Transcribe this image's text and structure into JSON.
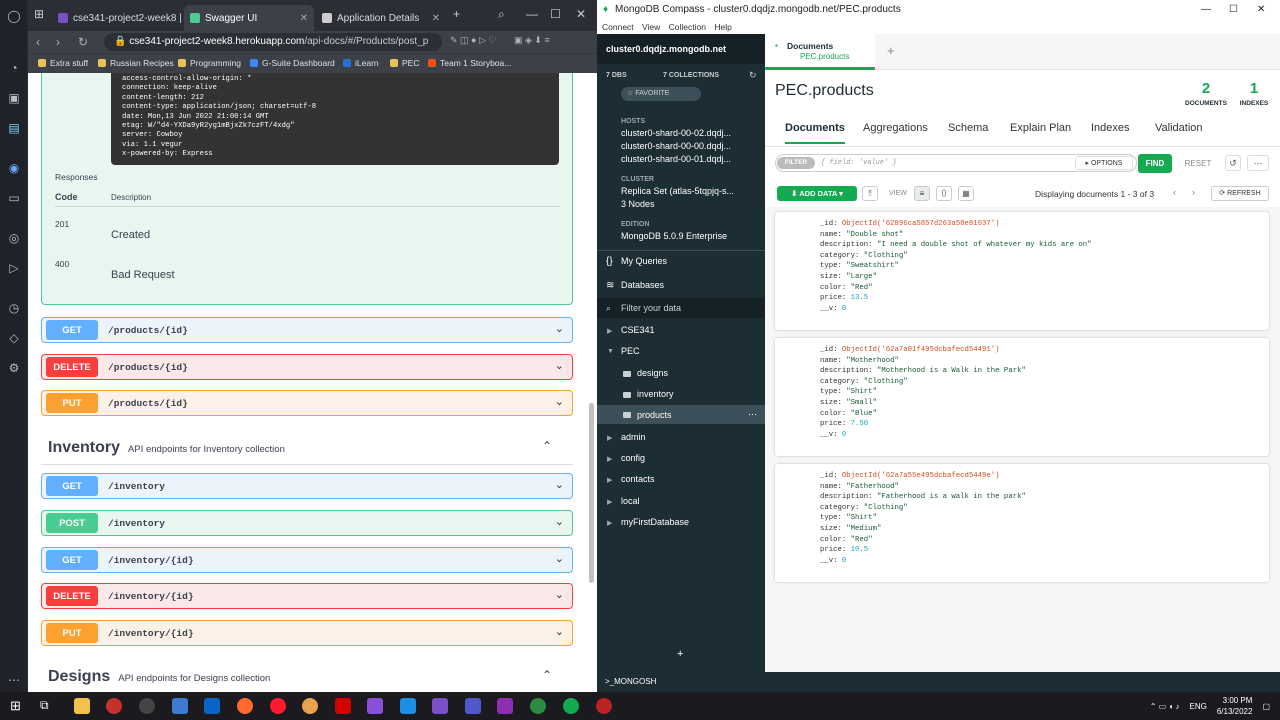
{
  "browser": {
    "tabs": [
      {
        "label": "cse341-project2-week8 | H",
        "color": "#7b4fc9"
      },
      {
        "label": "Swagger UI",
        "color": "#49cc90"
      },
      {
        "label": "Application Details",
        "color": "#cccccc"
      }
    ],
    "url_host": "cse341-project2-week8.herokuapp.com",
    "url_path": "/api-docs/#/Products/post_p",
    "bookmarks": [
      "Extra stuff",
      "Russian Recipes",
      "Programming",
      "G-Suite Dashboard",
      "iLearn",
      "PEC",
      "Team 1 Storyboa..."
    ]
  },
  "swagger": {
    "headers": [
      "access-control-allow-origin: *",
      "connection: keep-alive",
      "content-length: 212",
      "content-type: application/json; charset=utf-8",
      "date: Mon,13 Jun 2022 21:00:14 GMT",
      "etag: W/\"d4-YXDa9yR2yg1mBjxZk7czFT/4xdg\"",
      "server: Cowboy",
      "via: 1.1 vegur",
      "x-powered-by: Express"
    ],
    "responses_label": "Responses",
    "col_code": "Code",
    "col_desc": "Description",
    "responses": [
      {
        "code": "201",
        "desc": "Created"
      },
      {
        "code": "400",
        "desc": "Bad Request"
      }
    ],
    "product_ops": [
      {
        "method": "GET",
        "path": "/products/{id}"
      },
      {
        "method": "DELETE",
        "path": "/products/{id}"
      },
      {
        "method": "PUT",
        "path": "/products/{id}"
      }
    ],
    "inventory": {
      "name": "Inventory",
      "desc": "API endpoints for Inventory collection"
    },
    "inventory_ops": [
      {
        "method": "GET",
        "path": "/inventory"
      },
      {
        "method": "POST",
        "path": "/inventory"
      },
      {
        "method": "GET",
        "path": "/inventory/{id}"
      },
      {
        "method": "DELETE",
        "path": "/inventory/{id}"
      },
      {
        "method": "PUT",
        "path": "/inventory/{id}"
      }
    ],
    "designs": {
      "name": "Designs",
      "desc": "API endpoints for Designs collection"
    }
  },
  "compass": {
    "title": "MongoDB Compass - cluster0.dqdjz.mongodb.net/PEC.products",
    "menu": "Connect View Collection Help",
    "cluster": "cluster0.dqdjz.mongodb.net",
    "dbs": "7 DBS",
    "collections": "7 COLLECTIONS",
    "favorite": "☆ FAVORITE",
    "hosts_label": "HOSTS",
    "hosts": [
      "cluster0-shard-00-02.dqdj...",
      "cluster0-shard-00-00.dqdj...",
      "cluster0-shard-00-01.dqdj..."
    ],
    "cluster_label": "CLUSTER",
    "cluster_val": "Replica Set (atlas-5tqpjq-s...",
    "nodes": "3 Nodes",
    "edition_label": "EDITION",
    "edition": "MongoDB 5.0.9 Enterprise",
    "my_queries": "My Queries",
    "databases": "Databases",
    "filter_placeholder": "Filter your data",
    "dbs_tree": [
      "CSE341",
      "PEC",
      "admin",
      "config",
      "contacts",
      "local",
      "myFirstDatabase"
    ],
    "pec_collections": [
      "designs",
      "inventory",
      "products"
    ],
    "tab_label": "Documents",
    "tab_sub": "PEC.products",
    "coll_name": "PEC.products",
    "doc_count": "2",
    "doc_count_label": "DOCUMENTS",
    "idx_count": "1",
    "idx_label": "INDEXES",
    "tabs": [
      "Documents",
      "Aggregations",
      "Schema",
      "Explain Plan",
      "Indexes",
      "Validation"
    ],
    "filter_btn": "FILTER",
    "filter_text": "{ field: 'value' }",
    "options": "▸ OPTIONS",
    "find": "FIND",
    "reset": "RESET",
    "add_data": "⬇ ADD DATA ▾",
    "view": "VIEW",
    "displaying": "Displaying documents 1 - 3 of 3",
    "refresh": "⟳ REFRESH",
    "shell": ">_MONGOSH",
    "documents": [
      {
        "oid": "62896ca5857d263a58e81037",
        "name": "Double shot",
        "description": "I need a double shot of whatever my kids are on",
        "category": "Clothing",
        "type": "Sweatshirt",
        "size": "Large",
        "color": "Red",
        "price": "13.5",
        "v": "0"
      },
      {
        "oid": "62a7a01f495dcbafecd54491",
        "name": "Motherhood",
        "description": "Motherhood is a Walk in the Park",
        "category": "Clothing",
        "type": "Shirt",
        "size": "Small",
        "color": "Blue",
        "price": "7.50",
        "v": "0"
      },
      {
        "oid": "62a7a55e495dcbafecd5449e",
        "name": "Fatherhood",
        "description": "Fatherhood is a walk in the park",
        "category": "Clothing",
        "type": "Shirt",
        "size": "Medium",
        "color": "Red",
        "price": "10.5",
        "v": "0"
      }
    ]
  },
  "taskbar": {
    "lang": "ENG",
    "time": "3:00 PM",
    "date": "6/13/2022"
  }
}
